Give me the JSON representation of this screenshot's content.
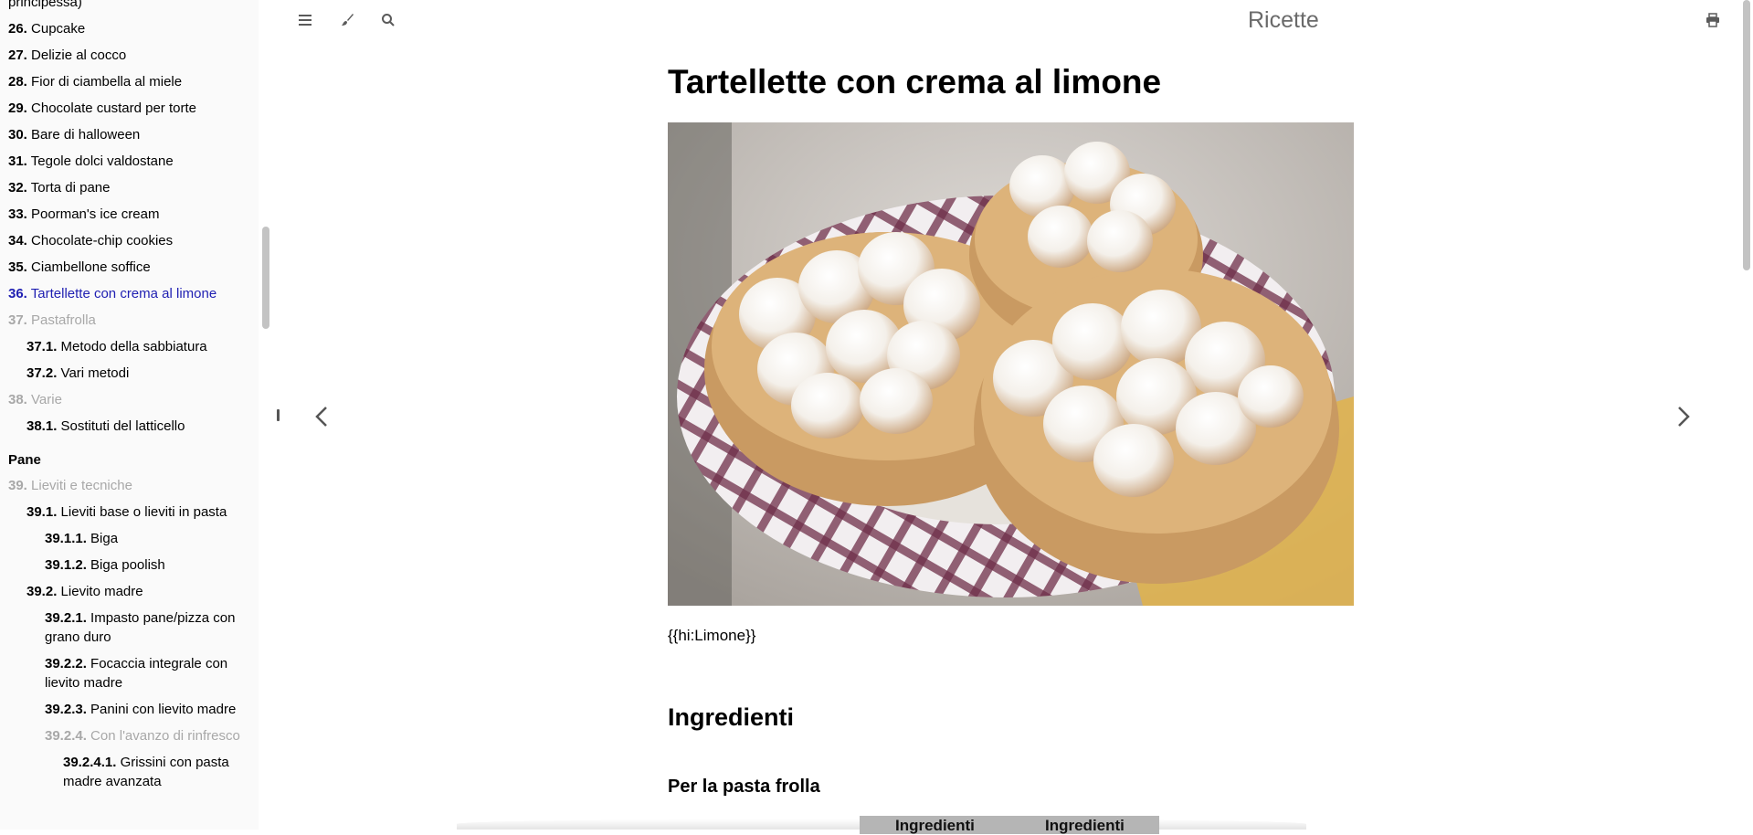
{
  "book_title": "Ricette",
  "toolbar": {
    "menu_icon": "hamburger-icon",
    "theme_icon": "paintbrush-icon",
    "search_icon": "search-icon",
    "print_icon": "printer-icon"
  },
  "colors": {
    "active_link": "#1f1fb2",
    "muted": "#a8a8a8",
    "sidebar_bg": "#fafafa"
  },
  "sidebar": {
    "items": [
      {
        "num": "",
        "label": "principessa)",
        "level": 1,
        "state": "normal"
      },
      {
        "num": "26.",
        "label": "Cupcake",
        "level": 1,
        "state": "normal"
      },
      {
        "num": "27.",
        "label": "Delizie al cocco",
        "level": 1,
        "state": "normal"
      },
      {
        "num": "28.",
        "label": "Fior di ciambella al miele",
        "level": 1,
        "state": "normal"
      },
      {
        "num": "29.",
        "label": "Chocolate custard per torte",
        "level": 1,
        "state": "normal"
      },
      {
        "num": "30.",
        "label": "Bare di halloween",
        "level": 1,
        "state": "normal"
      },
      {
        "num": "31.",
        "label": "Tegole dolci valdostane",
        "level": 1,
        "state": "normal"
      },
      {
        "num": "32.",
        "label": "Torta di pane",
        "level": 1,
        "state": "normal"
      },
      {
        "num": "33.",
        "label": "Poorman's ice cream",
        "level": 1,
        "state": "normal"
      },
      {
        "num": "34.",
        "label": "Chocolate-chip cookies",
        "level": 1,
        "state": "normal"
      },
      {
        "num": "35.",
        "label": "Ciambellone soffice",
        "level": 1,
        "state": "normal"
      },
      {
        "num": "36.",
        "label": "Tartellette con crema al limone",
        "level": 1,
        "state": "active"
      },
      {
        "num": "37.",
        "label": "Pastafrolla",
        "level": 1,
        "state": "muted"
      },
      {
        "num": "37.1.",
        "label": "Metodo della sabbiatura",
        "level": 2,
        "state": "normal"
      },
      {
        "num": "37.2.",
        "label": "Vari metodi",
        "level": 2,
        "state": "normal"
      },
      {
        "num": "38.",
        "label": "Varie",
        "level": 1,
        "state": "muted"
      },
      {
        "num": "38.1.",
        "label": "Sostituti del latticello",
        "level": 2,
        "state": "normal"
      },
      {
        "num": "",
        "label": "Pane",
        "level": 1,
        "state": "part"
      },
      {
        "num": "39.",
        "label": "Lieviti e tecniche",
        "level": 1,
        "state": "muted"
      },
      {
        "num": "39.1.",
        "label": "Lieviti base o lieviti in pasta",
        "level": 2,
        "state": "normal"
      },
      {
        "num": "39.1.1.",
        "label": "Biga",
        "level": 3,
        "state": "normal"
      },
      {
        "num": "39.1.2.",
        "label": "Biga poolish",
        "level": 3,
        "state": "normal"
      },
      {
        "num": "39.2.",
        "label": "Lievito madre",
        "level": 2,
        "state": "normal"
      },
      {
        "num": "39.2.1.",
        "label": "Impasto pane/pizza con grano duro",
        "level": 3,
        "state": "normal"
      },
      {
        "num": "39.2.2.",
        "label": "Focaccia integrale con lievito madre",
        "level": 3,
        "state": "normal"
      },
      {
        "num": "39.2.3.",
        "label": "Panini con lievito madre",
        "level": 3,
        "state": "normal"
      },
      {
        "num": "39.2.4.",
        "label": "Con l'avanzo di rinfresco",
        "level": 3,
        "state": "muted"
      },
      {
        "num": "39.2.4.1.",
        "label": "Grissini con pasta madre avanzata",
        "level": 4,
        "state": "normal"
      }
    ]
  },
  "page": {
    "title": "Tartellette con crema al limone",
    "caption": "{{hi:Limone}}",
    "section_heading": "Ingredienti",
    "subsection_heading": "Per la pasta frolla",
    "table_headers": [
      "Ingredienti",
      "Ingredienti"
    ]
  },
  "nav": {
    "prev_icon": "chevron-left-icon",
    "next_icon": "chevron-right-icon"
  }
}
